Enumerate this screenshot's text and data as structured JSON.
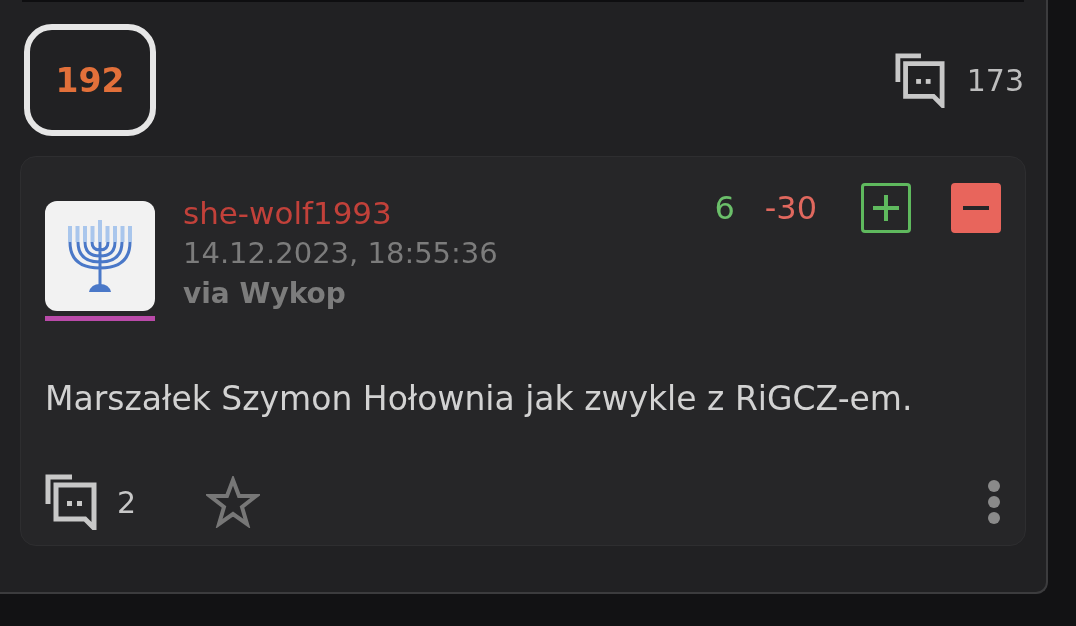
{
  "entry": {
    "votes": "192",
    "comments_count": "173"
  },
  "comment": {
    "author": "she-wolf1993",
    "date": "14.12.2023, 18:55:36",
    "source": "via Wykop",
    "plus_count": "6",
    "minus_count": "-30",
    "vote_buttons": [
      {
        "kind": "plus",
        "selected": false
      },
      {
        "kind": "minus",
        "selected": true
      }
    ],
    "text": "Marszałek Szymon Hołownia jak zwykle z RiGCZ-em.",
    "replies_count": "2",
    "favorited": false
  }
}
